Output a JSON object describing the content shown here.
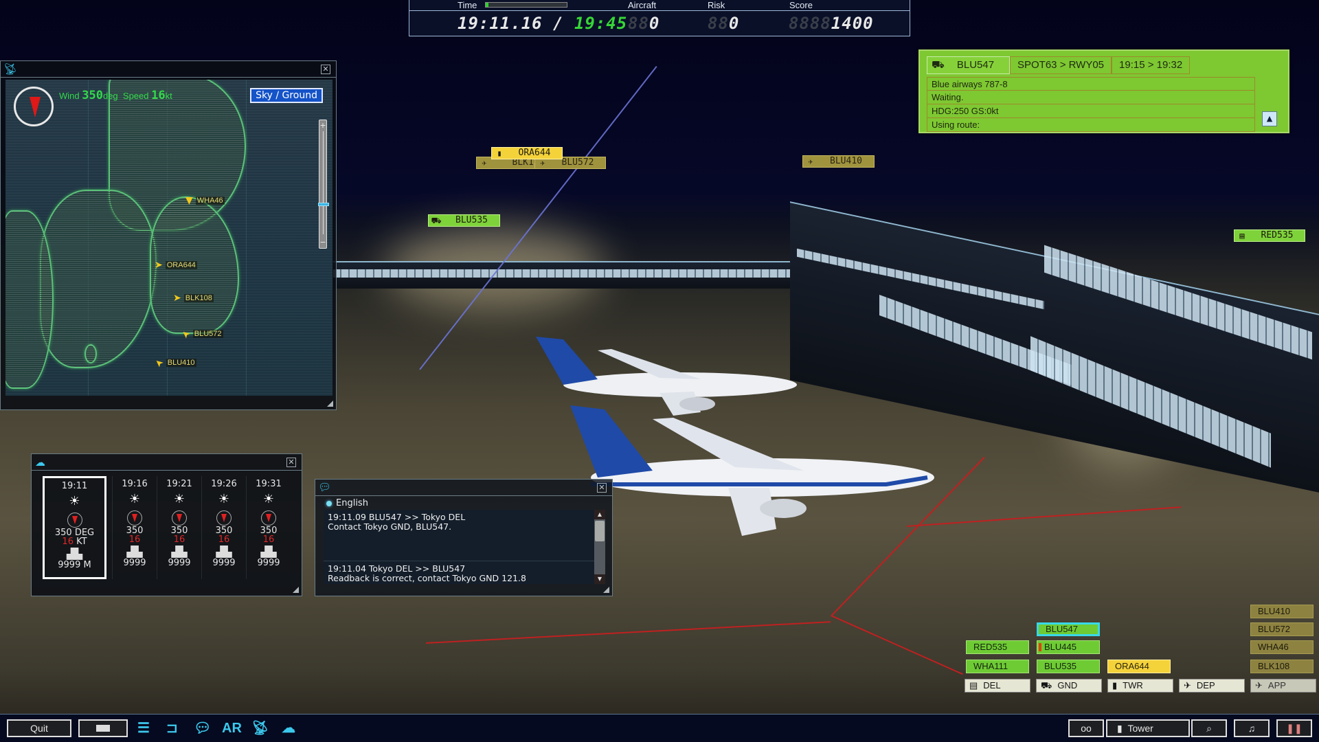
{
  "hud": {
    "time_label": "Time",
    "time_progress": 0.03,
    "time_current_dim": "19:11.16",
    "time_sep": "/",
    "time_end": "19:45",
    "aircraft_label": "Aircraft",
    "aircraft_value": "0",
    "risk_label": "Risk",
    "risk_value": "0",
    "score_label": "Score",
    "score_value": "1400"
  },
  "strip": {
    "callsign": "BLU547",
    "route": "SPOT63 > RWY05",
    "times": "19:15 > 19:32",
    "rows": [
      "Blue airways 787-8",
      "Waiting.",
      "HDG:250 GS:0kt",
      "Using route:"
    ],
    "collapse_glyph": "▲",
    "color": "#7ec832"
  },
  "scene_tags": [
    {
      "id": "ORA644",
      "type": "twr",
      "icon": "tower-icon"
    },
    {
      "id": "BLK108",
      "type": "app",
      "icon": "plane-arrival-icon"
    },
    {
      "id": "BLU572",
      "type": "app",
      "icon": "plane-arrival-icon"
    },
    {
      "id": "BLU410",
      "type": "app",
      "icon": "plane-arrival-icon"
    },
    {
      "id": "BLU535",
      "type": "gnd",
      "icon": "tug-icon"
    },
    {
      "id": "RED535",
      "type": "gnd",
      "icon": "clipboard-icon"
    }
  ],
  "map": {
    "wind_label": "Wind",
    "wind_dir": "350",
    "wind_dir_unit": "deg",
    "speed_label": "Speed",
    "wind_speed": "16",
    "wind_speed_unit": "kt",
    "mode_button": "Sky / Ground",
    "zoom_level": 0.15,
    "aircraft": [
      "WHA46",
      "ORA644",
      "BLK108",
      "BLU572",
      "BLU410"
    ]
  },
  "weather": {
    "forecasts": [
      {
        "time": "19:11",
        "dir": "350",
        "dir_unit": "DEG",
        "speed": "16",
        "speed_unit": "KT",
        "visibility": "9999",
        "vis_unit": "M"
      },
      {
        "time": "19:16",
        "dir": "350",
        "speed": "16",
        "visibility": "9999"
      },
      {
        "time": "19:21",
        "dir": "350",
        "speed": "16",
        "visibility": "9999"
      },
      {
        "time": "19:26",
        "dir": "350",
        "speed": "16",
        "visibility": "9999"
      },
      {
        "time": "19:31",
        "dir": "350",
        "speed": "16",
        "visibility": "9999"
      }
    ]
  },
  "chat": {
    "language": "English",
    "messages": [
      {
        "header": "19:11.09  BLU547 >> Tokyo DEL",
        "body": "Contact Tokyo GND, BLU547."
      },
      {
        "header": "19:11.04  Tokyo DEL >> BLU547",
        "body": "Readback is correct, contact Tokyo GND 121.8"
      }
    ]
  },
  "board": {
    "categories": [
      {
        "label": "DEL",
        "icon": "clipboard-icon",
        "strips": [
          "RED535",
          "WHA111"
        ]
      },
      {
        "label": "GND",
        "icon": "tug-icon",
        "strips": [
          "BLU547",
          "BLU445",
          "BLU535"
        ],
        "selected": "BLU547",
        "flagged": "BLU445"
      },
      {
        "label": "TWR",
        "icon": "tower-icon",
        "strips": [
          "ORA644"
        ]
      },
      {
        "label": "DEP",
        "icon": "plane-departure-icon",
        "strips": []
      },
      {
        "label": "APP",
        "icon": "plane-arrival-icon",
        "strips": [
          "BLU410",
          "BLU572",
          "WHA46",
          "BLK108"
        ]
      }
    ]
  },
  "toolbar": {
    "quit": "Quit",
    "ar": "AR",
    "view": "Tower"
  }
}
